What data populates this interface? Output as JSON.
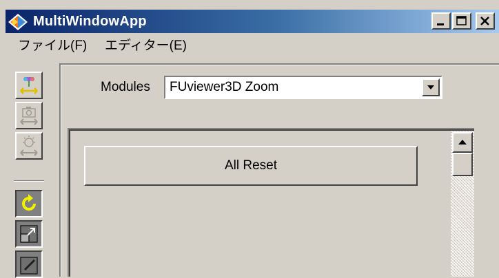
{
  "window": {
    "title": "MultiWindowApp",
    "icons": {
      "app": "app-icon",
      "minimize": "minimize-icon",
      "maximize": "maximize-icon",
      "close": "close-icon"
    }
  },
  "menu": {
    "items": [
      {
        "label": "ファイル(F)"
      },
      {
        "label": "エディター(E)"
      }
    ]
  },
  "toolbar": {
    "buttons": [
      {
        "icon": "move-pointer-icon"
      },
      {
        "icon": "camera-move-icon"
      },
      {
        "icon": "light-move-icon"
      },
      {
        "icon": "rotate-icon"
      },
      {
        "icon": "resize-icon"
      },
      {
        "icon": "edit-icon"
      }
    ]
  },
  "main": {
    "modules_label": "Modules",
    "modules_value": "FUviewer3D Zoom",
    "reset_button": "All Reset"
  },
  "colors": {
    "titlebar_start": "#0a246a",
    "titlebar_end": "#a6caf0",
    "face": "#d4d0c8",
    "rotate_accent": "#f0f000"
  }
}
